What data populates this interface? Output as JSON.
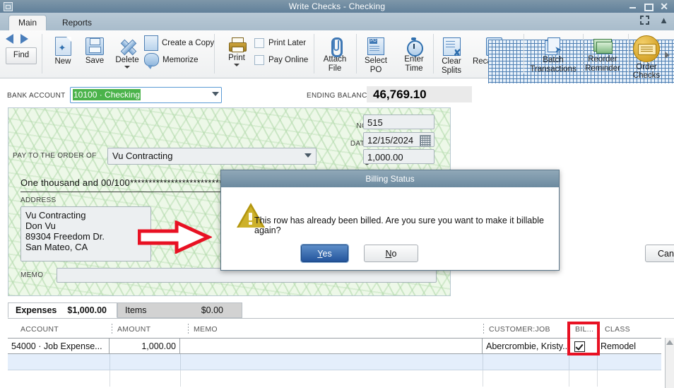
{
  "window": {
    "title": "Write Checks - Checking",
    "buttons": {
      "minimize": "minimize-button",
      "maximize": "maximize-button",
      "close": "✕"
    }
  },
  "tabs": {
    "items": [
      {
        "label": "Main",
        "active": true
      },
      {
        "label": "Reports",
        "active": false
      }
    ],
    "corner": {
      "expand": "expand-icon",
      "collapse": "chevron-up-icon"
    }
  },
  "ribbon": {
    "nav": {
      "back": "back-arrow-icon",
      "forward": "forward-arrow-icon",
      "find": "Find"
    },
    "buttons": [
      {
        "label": "New",
        "icon": "new-document-icon"
      },
      {
        "label": "Save",
        "icon": "save-icon"
      },
      {
        "label": "Delete",
        "icon": "delete-x-icon",
        "has_dropdown": true
      },
      {
        "label": "Create a Copy",
        "icon": "copy-icon"
      },
      {
        "label": "Memorize",
        "icon": "memorize-icon"
      },
      {
        "label": "Print",
        "icon": "printer-icon",
        "has_dropdown": true
      },
      {
        "label": "Attach File",
        "icon": "paperclip-icon"
      },
      {
        "label": "Select PO",
        "icon": "purchase-order-icon"
      },
      {
        "label": "Enter Time",
        "icon": "stopwatch-icon"
      },
      {
        "label": "Clear Splits",
        "icon": "clear-splits-icon"
      },
      {
        "label": "Recalculate",
        "icon": "calculator-icon"
      },
      {
        "label": "Batch Transactions",
        "icon": "batch-transactions-icon"
      },
      {
        "label": "Reorder Reminder",
        "icon": "reorder-reminder-icon"
      },
      {
        "label": "Order Checks",
        "icon": "order-checks-icon"
      }
    ],
    "checkboxes": [
      {
        "label": "Print Later",
        "checked": false
      },
      {
        "label": "Pay Online",
        "checked": false
      }
    ],
    "overflow": "more-commands-arrow"
  },
  "header": {
    "bank_account_label": "BANK ACCOUNT",
    "bank_account_value": "10100 · Checking",
    "ending_balance_label": "ENDING BALANCE",
    "ending_balance_value": "46,769.10"
  },
  "check": {
    "no_label": "NO.",
    "no_value": "515",
    "date_label": "DATE",
    "date_value": "12/15/2024",
    "amount_symbol": "$",
    "amount_value": "1,000.00",
    "pay_to_label": "PAY TO THE ORDER OF",
    "pay_to_value": "Vu Contracting",
    "amount_in_words": "One thousand  and 00/100******************************************",
    "address_label": "ADDRESS",
    "address_value": "Vu Contracting\nDon Vu\n89304 Freedom Dr.\nSan Mateo, CA",
    "memo_label": "MEMO",
    "memo_value": ""
  },
  "expenses": {
    "tabs": [
      {
        "label": "Expenses",
        "amount": "$1,000.00",
        "active": true
      },
      {
        "label": "Items",
        "amount": "$0.00",
        "active": false
      }
    ],
    "columns": [
      "ACCOUNT",
      "AMOUNT",
      "MEMO",
      "CUSTOMER:JOB",
      "BIL...",
      "CLASS"
    ],
    "rows": [
      {
        "account": "54000 · Job Expense...",
        "amount": "1,000.00",
        "memo": "",
        "customer_job": "Abercrombie, Kristy...",
        "billable": true,
        "class": "Remodel"
      }
    ]
  },
  "dialog": {
    "title": "Billing Status",
    "icon": "warning-triangle-icon",
    "message": "This row has already been billed. Are you sure you want to make it billable again?",
    "buttons": [
      {
        "label": "Yes",
        "accel": "Y",
        "primary": true
      },
      {
        "label": "No",
        "accel": "N",
        "primary": false
      },
      {
        "label": "Cancel",
        "accel": "",
        "primary": false
      }
    ]
  },
  "annotations": {
    "arrow_target": "Yes",
    "highlight_box": "BIL... billable column",
    "color": "#e81123"
  }
}
